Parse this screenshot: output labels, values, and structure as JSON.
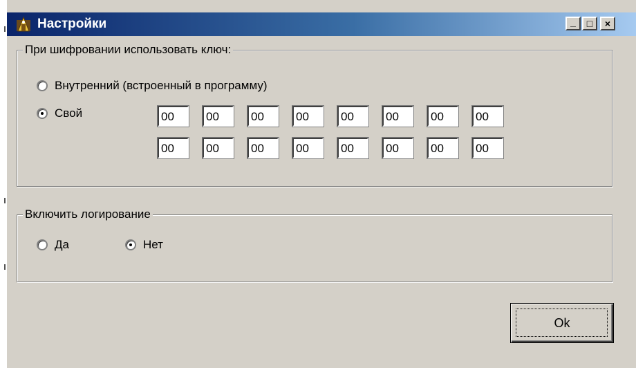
{
  "window": {
    "title": "Настройки",
    "icon": "app-icon",
    "controls": {
      "minimize": "_",
      "maximize": "□",
      "close": "×"
    }
  },
  "encryption_group": {
    "title": "При шифровании использовать ключ:",
    "options": [
      {
        "label": "Внутренний (встроенный в программу)",
        "checked": false
      },
      {
        "label": "Свой",
        "checked": true
      }
    ],
    "key_row_1": [
      "00",
      "00",
      "00",
      "00",
      "00",
      "00",
      "00",
      "00"
    ],
    "key_row_2": [
      "00",
      "00",
      "00",
      "00",
      "00",
      "00",
      "00",
      "00"
    ]
  },
  "logging_group": {
    "title": "Включить логирование",
    "options": [
      {
        "label": "Да",
        "checked": false
      },
      {
        "label": "Нет",
        "checked": true
      }
    ]
  },
  "ok_button": {
    "label": "Ok"
  },
  "colors": {
    "face": "#d4d0c8",
    "title_start": "#0a246a",
    "title_end": "#a6caf0"
  }
}
